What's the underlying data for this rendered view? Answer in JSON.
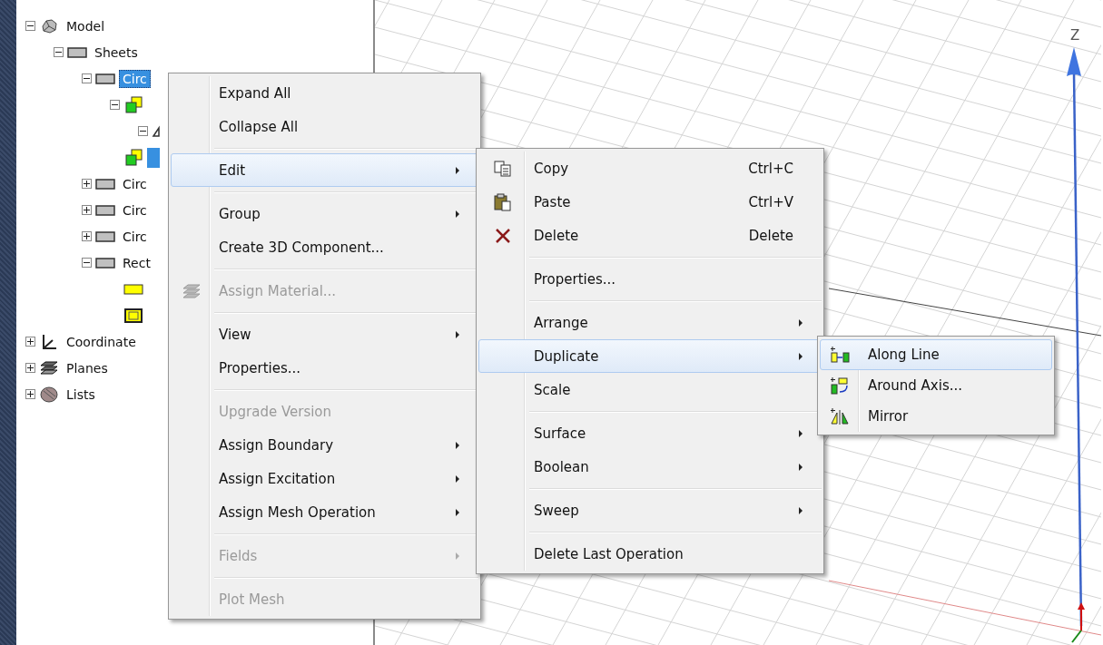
{
  "tree": [
    {
      "label": "Model",
      "kind": "model",
      "expanded": true,
      "selected": false,
      "children": [
        {
          "label": "Sheets",
          "kind": "sheet",
          "expanded": true,
          "selected": false,
          "children": [
            {
              "label": "Circ",
              "kind": "sheet",
              "expanded": true,
              "selected": true,
              "children": [
                {
                  "kind": "operation",
                  "expanded": true,
                  "children": [
                    {
                      "kind": "partial",
                      "expanded": true
                    }
                  ]
                },
                {
                  "kind": "operation",
                  "selected": true
                }
              ]
            },
            {
              "label": "Circ",
              "kind": "sheet",
              "expanded": false,
              "selected": false
            },
            {
              "label": "Circ",
              "kind": "sheet",
              "expanded": false,
              "selected": false
            },
            {
              "label": "Circ",
              "kind": "sheet",
              "expanded": false,
              "selected": false
            },
            {
              "label": "Rect",
              "kind": "sheet",
              "expanded": true,
              "selected": false,
              "children": [
                {
                  "kind": "yellow-rect"
                },
                {
                  "kind": "yellow-frame"
                }
              ]
            }
          ]
        }
      ]
    },
    {
      "label": "Coordinate",
      "kind": "coordinate",
      "expanded": false,
      "selected": false
    },
    {
      "label": "Planes",
      "kind": "planes",
      "expanded": false,
      "selected": false
    },
    {
      "label": "Lists",
      "kind": "lists",
      "expanded": false,
      "selected": false
    }
  ],
  "viewport": {
    "axis_label": "Z"
  },
  "context_menu": [
    {
      "kind": "item",
      "label": "Expand All",
      "submenu": false,
      "disabled": false,
      "selected": false
    },
    {
      "kind": "item",
      "label": "Collapse All",
      "submenu": false,
      "disabled": false,
      "selected": false
    },
    {
      "kind": "separator"
    },
    {
      "kind": "item",
      "label": "Edit",
      "submenu": true,
      "disabled": false,
      "selected": true
    },
    {
      "kind": "separator"
    },
    {
      "kind": "item",
      "label": "Group",
      "submenu": true,
      "disabled": false,
      "selected": false
    },
    {
      "kind": "item",
      "label": "Create 3D Component...",
      "submenu": false,
      "disabled": false,
      "selected": false
    },
    {
      "kind": "separator"
    },
    {
      "kind": "material",
      "label": "Assign Material...",
      "submenu": false,
      "disabled": true,
      "selected": false
    },
    {
      "kind": "separator"
    },
    {
      "kind": "item",
      "label": "View",
      "submenu": true,
      "disabled": false,
      "selected": false
    },
    {
      "kind": "item",
      "label": "Properties...",
      "submenu": false,
      "disabled": false,
      "selected": false
    },
    {
      "kind": "separator"
    },
    {
      "kind": "item",
      "label": "Upgrade Version",
      "submenu": false,
      "disabled": true,
      "selected": false
    },
    {
      "kind": "item",
      "label": "Assign Boundary",
      "submenu": true,
      "disabled": false,
      "selected": false
    },
    {
      "kind": "item",
      "label": "Assign Excitation",
      "submenu": true,
      "disabled": false,
      "selected": false
    },
    {
      "kind": "item",
      "label": "Assign Mesh Operation",
      "submenu": true,
      "disabled": false,
      "selected": false
    },
    {
      "kind": "separator"
    },
    {
      "kind": "item",
      "label": "Fields",
      "submenu": true,
      "disabled": true,
      "selected": false
    },
    {
      "kind": "separator"
    },
    {
      "kind": "item",
      "label": "Plot Mesh",
      "submenu": false,
      "disabled": true,
      "selected": false
    }
  ],
  "edit_menu": [
    {
      "kind": "copy",
      "label": "Copy",
      "shortcut": "Ctrl+C",
      "submenu": false,
      "disabled": false,
      "selected": false
    },
    {
      "kind": "paste",
      "label": "Paste",
      "shortcut": "Ctrl+V",
      "submenu": false,
      "disabled": false,
      "selected": false
    },
    {
      "kind": "delete",
      "label": "Delete",
      "shortcut": "Delete",
      "submenu": false,
      "disabled": false,
      "selected": false
    },
    {
      "kind": "separator"
    },
    {
      "kind": "item",
      "label": "Properties...",
      "submenu": false,
      "disabled": false,
      "selected": false
    },
    {
      "kind": "separator"
    },
    {
      "kind": "item",
      "label": "Arrange",
      "submenu": true,
      "disabled": false,
      "selected": false
    },
    {
      "kind": "item",
      "label": "Duplicate",
      "submenu": true,
      "disabled": false,
      "selected": true
    },
    {
      "kind": "item",
      "label": "Scale",
      "submenu": false,
      "disabled": false,
      "selected": false
    },
    {
      "kind": "separator"
    },
    {
      "kind": "item",
      "label": "Surface",
      "submenu": true,
      "disabled": false,
      "selected": false
    },
    {
      "kind": "item",
      "label": "Boolean",
      "submenu": true,
      "disabled": false,
      "selected": false
    },
    {
      "kind": "separator"
    },
    {
      "kind": "item",
      "label": "Sweep",
      "submenu": true,
      "disabled": false,
      "selected": false
    },
    {
      "kind": "separator"
    },
    {
      "kind": "item",
      "label": "Delete Last Operation",
      "submenu": false,
      "disabled": false,
      "selected": false
    }
  ],
  "duplicate_menu": [
    {
      "kind": "along-line",
      "label": "Along Line",
      "submenu": false,
      "disabled": false,
      "selected": true
    },
    {
      "kind": "around-axis",
      "label": "Around Axis...",
      "submenu": false,
      "disabled": false,
      "selected": false
    },
    {
      "kind": "mirror",
      "label": "Mirror",
      "submenu": false,
      "disabled": false,
      "selected": false
    }
  ]
}
